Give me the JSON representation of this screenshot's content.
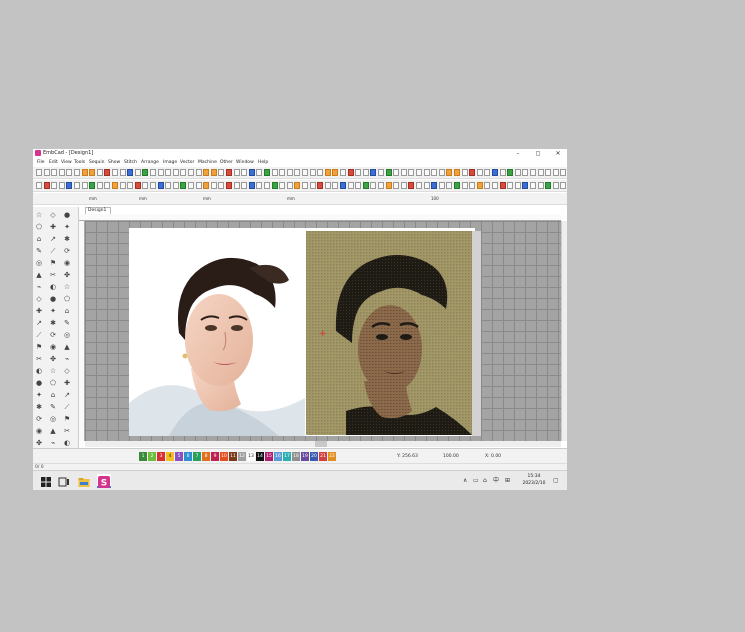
{
  "window": {
    "title": "EmbCad - [Design1]",
    "minimize": "–",
    "maximize": "◻",
    "close": "✕",
    "app_icon": "embcad-logo-icon"
  },
  "menu": [
    "File",
    "Edit",
    "View",
    "Tools",
    "Sequin",
    "Show",
    "Stitch",
    "Arrange",
    "Image",
    "Vector",
    "Machine",
    "Other",
    "Window",
    "Help"
  ],
  "toolbar": {
    "unit1": "mm",
    "unit2": "mm",
    "unit3": "mm",
    "unit4": "mm",
    "zoom": "100"
  },
  "document": {
    "tab": "Design1"
  },
  "colorbar": {
    "swatches": [
      {
        "label": "1",
        "color": "#3a8a3a"
      },
      {
        "label": "2",
        "color": "#6fbf3f"
      },
      {
        "label": "3",
        "color": "#d83030"
      },
      {
        "label": "4",
        "color": "#f0c020"
      },
      {
        "label": "5",
        "color": "#8a4fc0"
      },
      {
        "label": "6",
        "color": "#2f8fd0"
      },
      {
        "label": "7",
        "color": "#2aa060"
      },
      {
        "label": "8",
        "color": "#e07020"
      },
      {
        "label": "9",
        "color": "#c02050"
      },
      {
        "label": "10",
        "color": "#e05020"
      },
      {
        "label": "11",
        "color": "#7a3a1a"
      },
      {
        "label": "12",
        "color": "#a0a0a0"
      },
      {
        "label": "13",
        "color": "#ffffff"
      },
      {
        "label": "14",
        "color": "#111111"
      },
      {
        "label": "15",
        "color": "#b02070"
      },
      {
        "label": "16",
        "color": "#5a9ad8"
      },
      {
        "label": "17",
        "color": "#2ab0b0"
      },
      {
        "label": "18",
        "color": "#909090"
      },
      {
        "label": "19",
        "color": "#6a4aa0"
      },
      {
        "label": "20",
        "color": "#3a5ab0"
      },
      {
        "label": "21",
        "color": "#d04040"
      },
      {
        "label": "22",
        "color": "#e09020"
      }
    ],
    "y_coord": "Y: 256.63",
    "width_value": "100.00",
    "x_coord": "X: 0.00"
  },
  "status": {
    "text": "0/ 0"
  },
  "taskbar": {
    "tray_input": "中",
    "time": "15:34",
    "date": "2023/2/10"
  }
}
